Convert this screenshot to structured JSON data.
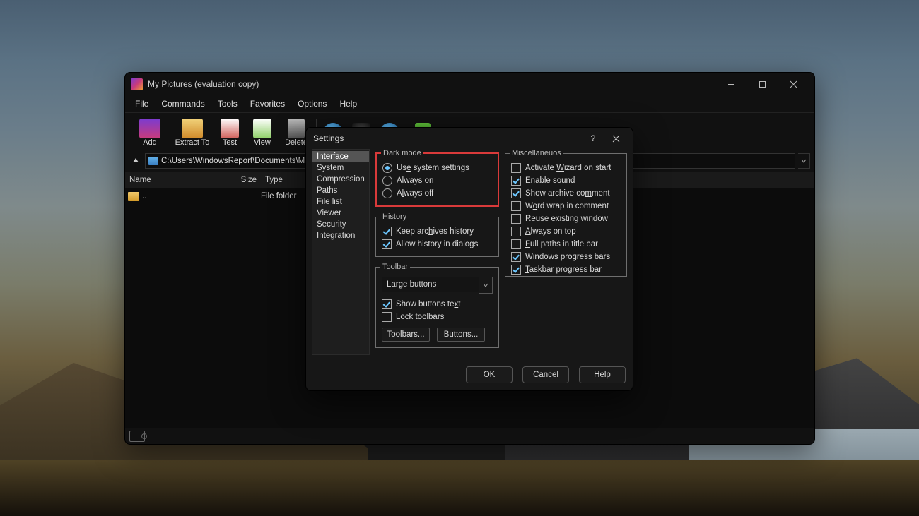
{
  "winrar": {
    "title": "My Pictures (evaluation copy)",
    "menu": [
      "File",
      "Commands",
      "Tools",
      "Favorites",
      "Options",
      "Help"
    ],
    "toolbar": [
      "Add",
      "Extract To",
      "Test",
      "View",
      "Delete"
    ],
    "address": "C:\\Users\\WindowsReport\\Documents\\My Pic",
    "cols": {
      "name": "Name",
      "size": "Size",
      "type": "Type"
    },
    "rows": [
      {
        "name": "..",
        "size": "",
        "type": "File folder"
      }
    ]
  },
  "settings": {
    "title": "Settings",
    "categories": [
      "Interface",
      "System",
      "Compression",
      "Paths",
      "File list",
      "Viewer",
      "Security",
      "Integration"
    ],
    "selected_category": "Interface",
    "dark_mode": {
      "legend": "Dark mode",
      "options": [
        "Use system settings",
        "Always on",
        "Always off"
      ],
      "uletters": [
        "e",
        "n",
        "l"
      ],
      "selected": 0
    },
    "history": {
      "legend": "History",
      "items": [
        {
          "label": "Keep archives history",
          "checked": true,
          "ul": "h"
        },
        {
          "label": "Allow history in dialogs",
          "checked": true,
          "ul": ""
        }
      ]
    },
    "toolbar": {
      "legend": "Toolbar",
      "combo": "Large buttons",
      "items": [
        {
          "label": "Show buttons text",
          "checked": true,
          "ul": "x"
        },
        {
          "label": "Lock toolbars",
          "checked": false,
          "ul": "c"
        }
      ],
      "btns": [
        "Toolbars...",
        "Buttons..."
      ]
    },
    "misc": {
      "legend": "Miscellaneuos",
      "items": [
        {
          "label": "Activate Wizard on start",
          "checked": false,
          "ul": "W"
        },
        {
          "label": "Enable sound",
          "checked": true,
          "ul": "s"
        },
        {
          "label": "Show archive comment",
          "checked": true,
          "ul": "m"
        },
        {
          "label": "Word wrap in comment",
          "checked": false,
          "ul": "o"
        },
        {
          "label": "Reuse existing window",
          "checked": false,
          "ul": "R"
        },
        {
          "label": "Always on top",
          "checked": false,
          "ul": "A"
        },
        {
          "label": "Full paths in title bar",
          "checked": false,
          "ul": "F"
        },
        {
          "label": "Windows progress bars",
          "checked": true,
          "ul": "i"
        },
        {
          "label": "Taskbar progress bar",
          "checked": true,
          "ul": "T"
        }
      ]
    },
    "buttons": {
      "ok": "OK",
      "cancel": "Cancel",
      "help": "Help"
    }
  }
}
